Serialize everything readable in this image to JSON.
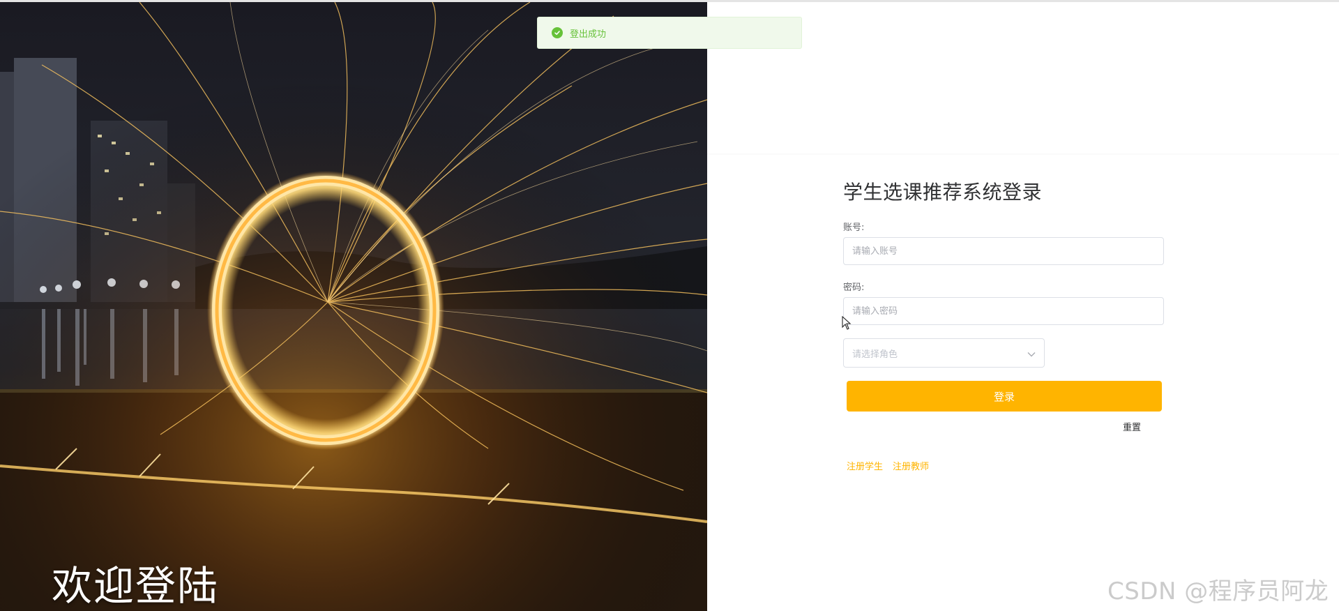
{
  "hero": {
    "welcome_text": "欢迎登陆"
  },
  "toast": {
    "message": "登出成功",
    "icon": "check-circle-icon",
    "color": "#67c23a"
  },
  "form": {
    "title": "学生选课推荐系统登录",
    "account_label": "账号:",
    "account_placeholder": "请输入账号",
    "password_label": "密码:",
    "password_placeholder": "请输入密码",
    "role_placeholder": "请选择角色",
    "login_button": "登录",
    "reset_button": "重置",
    "register_student": "注册学生",
    "register_teacher": "注册教师",
    "accent_color": "#ffb400"
  },
  "watermark": "CSDN @程序员阿龙"
}
